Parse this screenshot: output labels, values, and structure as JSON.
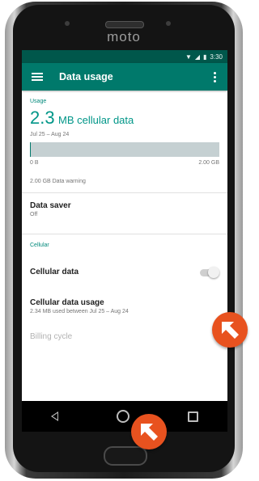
{
  "device": {
    "brand": "moto"
  },
  "status_bar": {
    "time": "3:30"
  },
  "app_bar": {
    "title": "Data usage",
    "menu_icon": "hamburger-icon",
    "overflow_icon": "more-vert-icon"
  },
  "usage": {
    "section_label": "Usage",
    "amount_value": "2.3",
    "amount_unit": "MB cellular data",
    "date_range": "Jul 25 – Aug 24",
    "bar_min_label": "0 B",
    "bar_max_label": "2.00 GB",
    "bar_fill_fraction": 0.001,
    "warning": "2.00 GB Data warning"
  },
  "data_saver": {
    "title": "Data saver",
    "subtitle": "Off"
  },
  "cellular": {
    "section_label": "Cellular",
    "cellular_data_label": "Cellular data",
    "cellular_data_enabled": false,
    "cellular_usage_title": "Cellular data usage",
    "cellular_usage_subtitle": "2.34 MB used between Jul 25 – Aug 24",
    "billing_cycle_label": "Billing cycle"
  },
  "navigation": {
    "back": "back-icon",
    "home": "home-icon",
    "recents": "recents-icon"
  },
  "colors": {
    "accent": "#009688",
    "app_bar": "#00796b",
    "status_bar": "#00574b",
    "badge": "#e8521f"
  }
}
